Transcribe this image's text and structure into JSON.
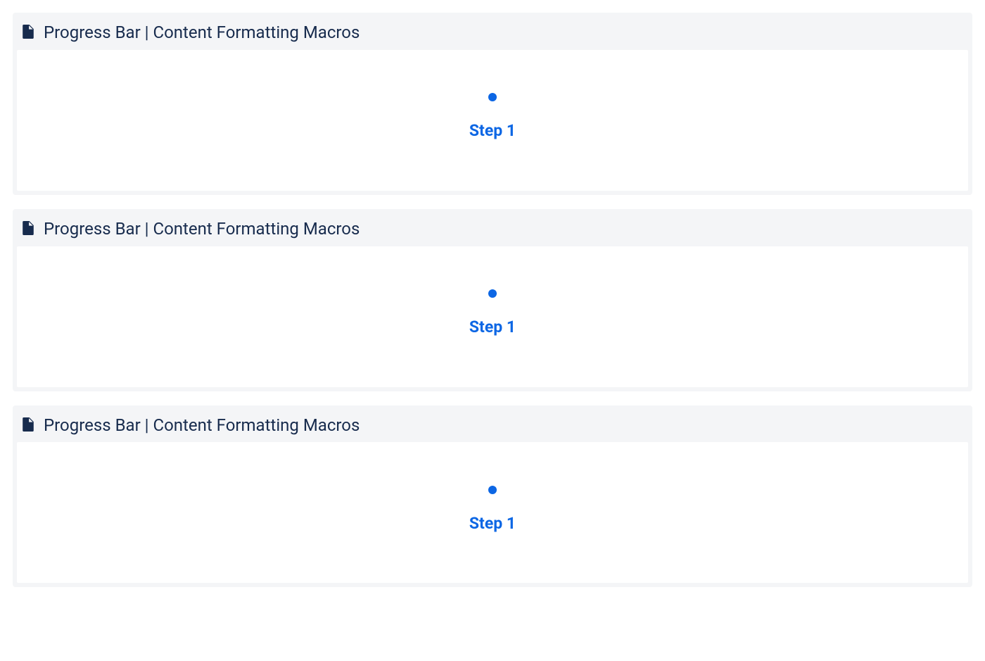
{
  "macros": [
    {
      "title": "Progress Bar | Content Formatting Macros",
      "step_label": "Step 1"
    },
    {
      "title": "Progress Bar | Content Formatting Macros",
      "step_label": "Step 1"
    },
    {
      "title": "Progress Bar | Content Formatting Macros",
      "step_label": "Step 1"
    }
  ],
  "colors": {
    "accent": "#0c66e4",
    "heading": "#172b4d",
    "panel_bg": "#f4f5f7"
  }
}
